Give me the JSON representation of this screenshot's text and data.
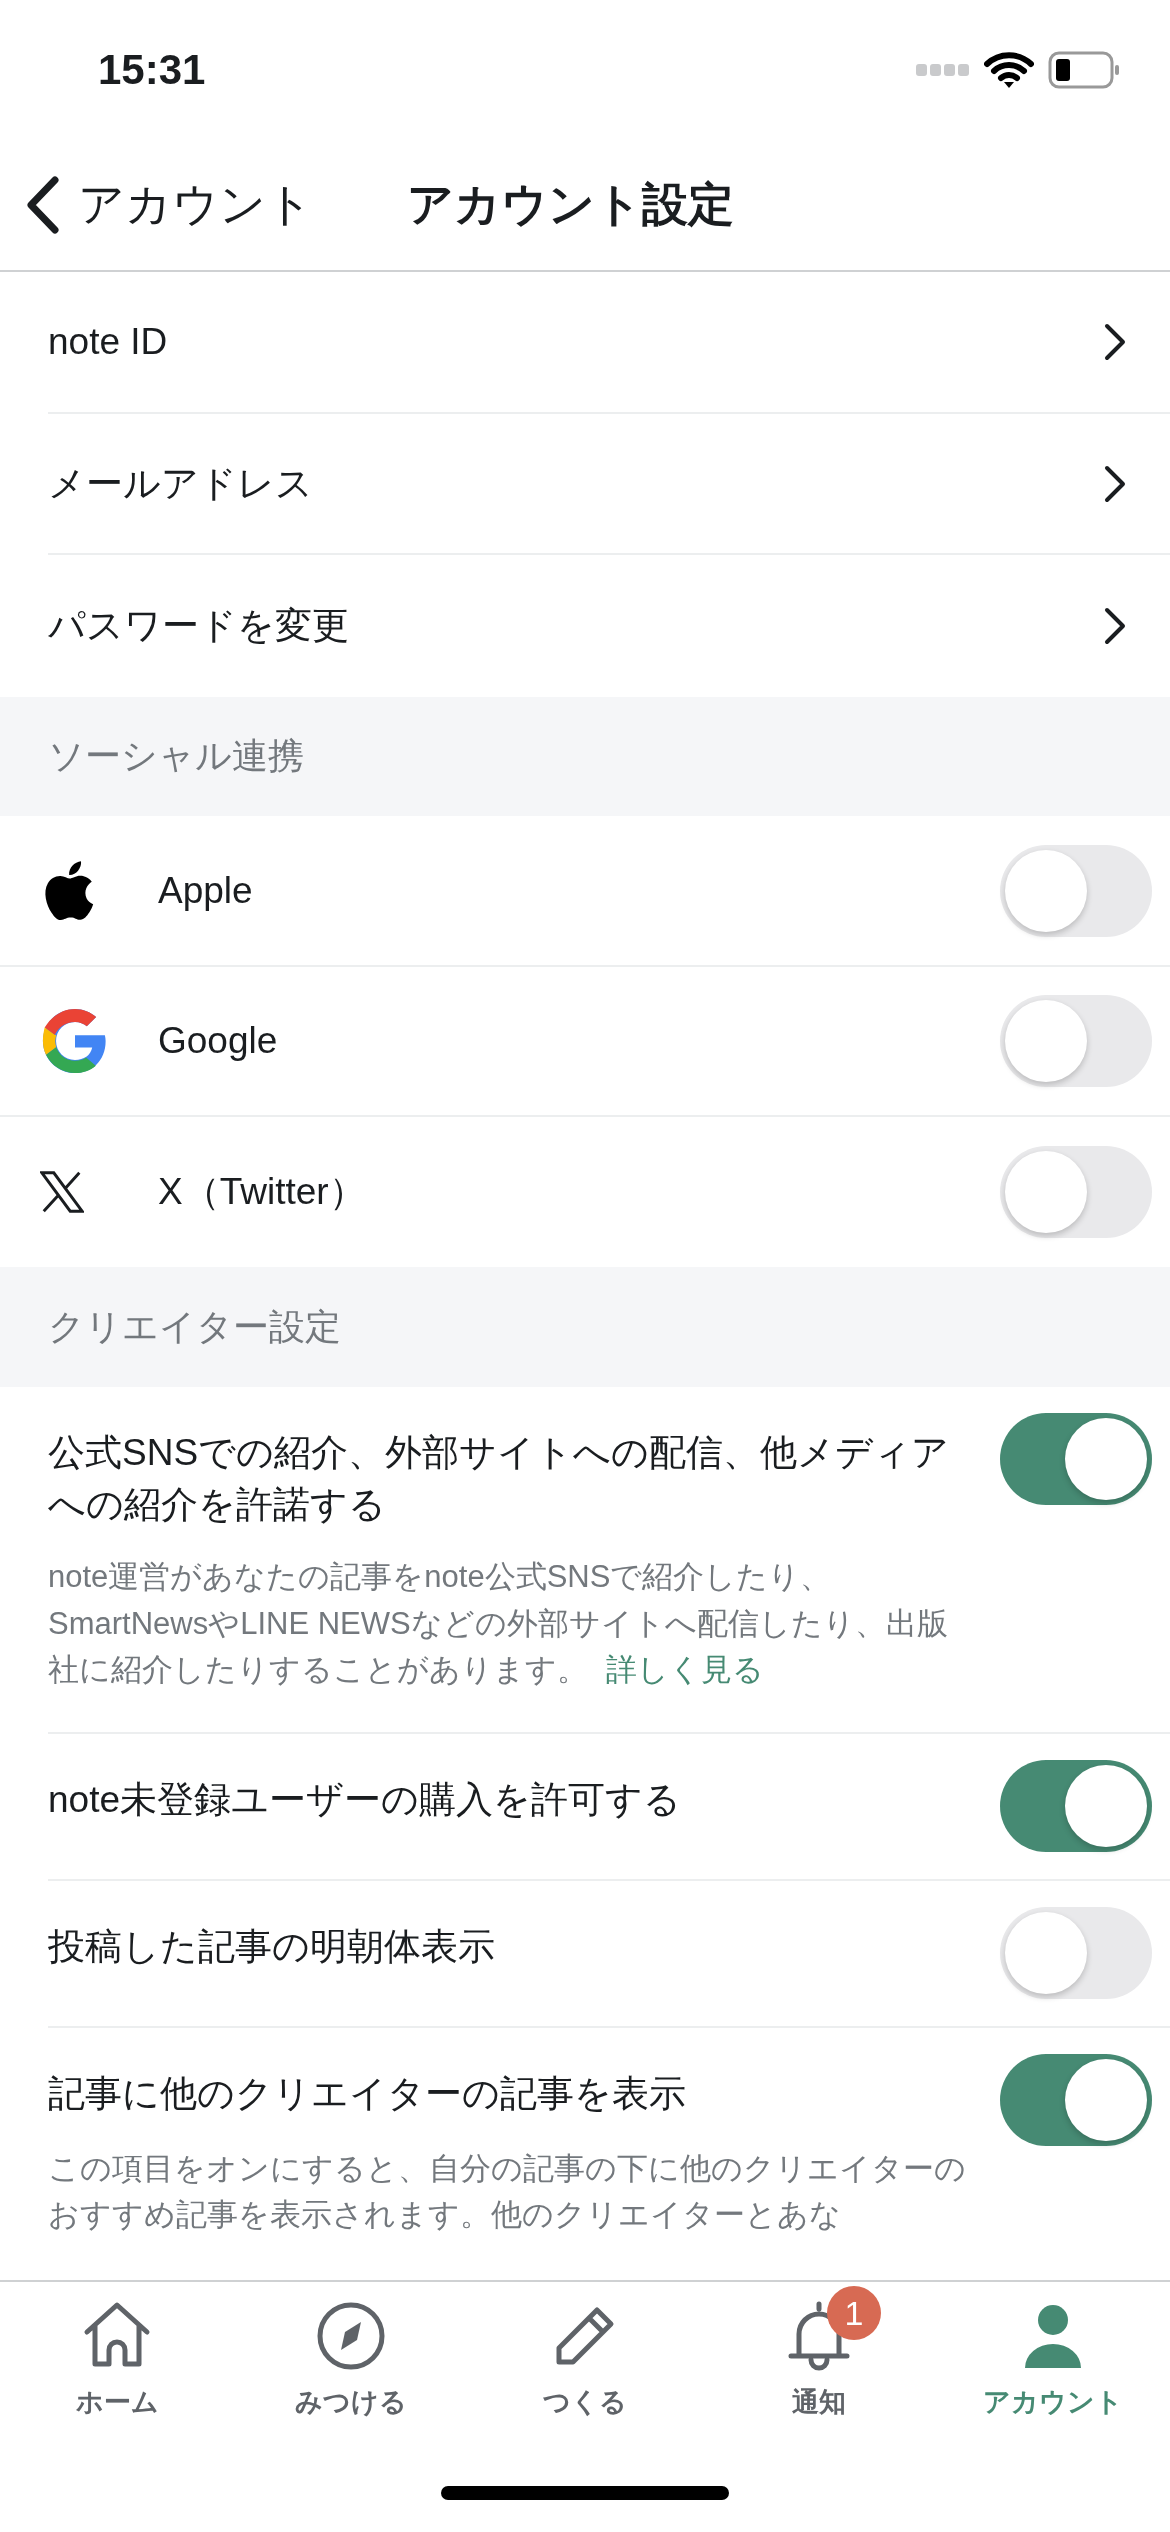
{
  "status_bar": {
    "time": "15:31"
  },
  "nav": {
    "back_label": "アカウント",
    "title": "アカウント設定"
  },
  "account_items": [
    {
      "label": "note ID"
    },
    {
      "label": "メールアドレス"
    },
    {
      "label": "パスワードを変更"
    }
  ],
  "social": {
    "header": "ソーシャル連携",
    "items": [
      {
        "kind": "apple",
        "label": "Apple",
        "on": false
      },
      {
        "kind": "google",
        "label": "Google",
        "on": false
      },
      {
        "kind": "x",
        "label": "X（Twitter）",
        "on": false
      }
    ]
  },
  "creator": {
    "header": "クリエイター設定",
    "items": [
      {
        "label": "公式SNSでの紹介、外部サイトへの配信、他メディアへの紹介を許諾する",
        "on": true,
        "description": "note運営があなたの記事をnote公式SNSで紹介したり、SmartNewsやLINE NEWSなどの外部サイトへ配信したり、出版社に紹介したりすることがあります。",
        "link": "詳しく見る"
      },
      {
        "label": "note未登録ユーザーの購入を許可する",
        "on": true
      },
      {
        "label": "投稿した記事の明朝体表示",
        "on": false
      },
      {
        "label": "記事に他のクリエイターの記事を表示",
        "on": true,
        "description": "この項目をオンにすると、自分の記事の下に他のクリエイターのおすすめ記事を表示されます。他のクリエイターとあな"
      }
    ]
  },
  "tab_bar": {
    "items": [
      {
        "kind": "home",
        "label": "ホーム",
        "selected": false
      },
      {
        "kind": "discover",
        "label": "みつける",
        "selected": false
      },
      {
        "kind": "create",
        "label": "つくる",
        "selected": false
      },
      {
        "kind": "notice",
        "label": "通知",
        "selected": false,
        "badge": "1"
      },
      {
        "kind": "account",
        "label": "アカウント",
        "selected": true
      }
    ]
  }
}
